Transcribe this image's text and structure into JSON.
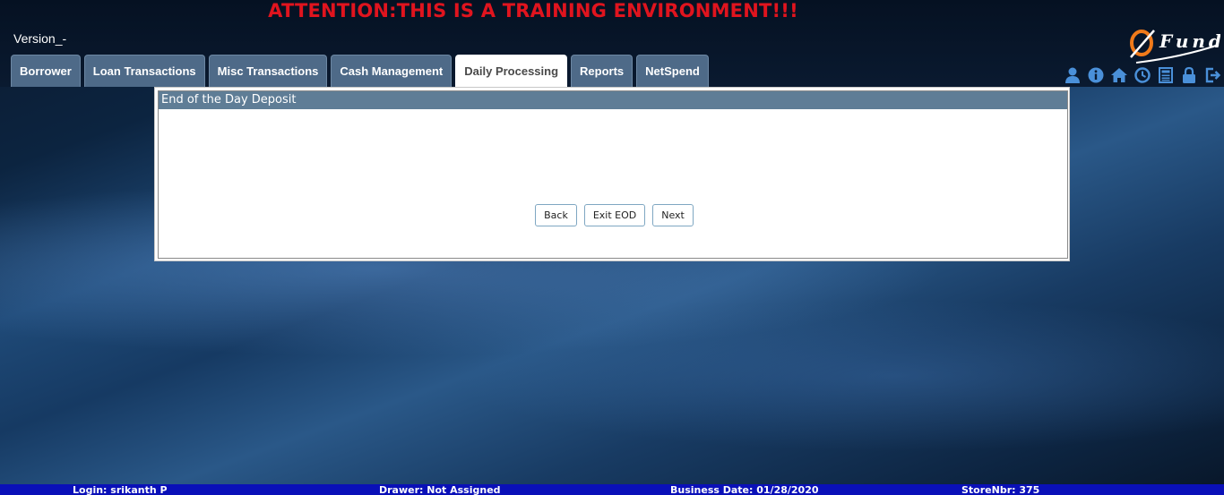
{
  "banner": "ATTENTION:THIS IS A TRAINING ENVIRONMENT!!!",
  "version": "Version_-",
  "logo_text": "Fund",
  "tabs": [
    {
      "label": "Borrower",
      "active": false
    },
    {
      "label": "Loan Transactions",
      "active": false
    },
    {
      "label": "Misc Transactions",
      "active": false
    },
    {
      "label": "Cash Management",
      "active": false
    },
    {
      "label": "Daily Processing",
      "active": true
    },
    {
      "label": "Reports",
      "active": false
    },
    {
      "label": "NetSpend",
      "active": false
    }
  ],
  "toolbar_icons": [
    "user-icon",
    "info-icon",
    "home-icon",
    "clock-icon",
    "calculator-icon",
    "lock-icon",
    "logout-icon"
  ],
  "panel": {
    "title": "End of the Day Deposit",
    "buttons": {
      "back": "Back",
      "exit": "Exit EOD",
      "next": "Next"
    }
  },
  "status": {
    "login": "Login: srikanth P",
    "drawer": "Drawer: Not Assigned",
    "business_date": "Business Date: 01/28/2020",
    "store": "StoreNbr: 375"
  },
  "colors": {
    "banner": "#e0141e",
    "tab": "#4e6a88",
    "panel_header": "#5f7d96",
    "statusbar": "#0a10b8",
    "icon": "#4a90d9",
    "logo_accent": "#f07a1a"
  }
}
